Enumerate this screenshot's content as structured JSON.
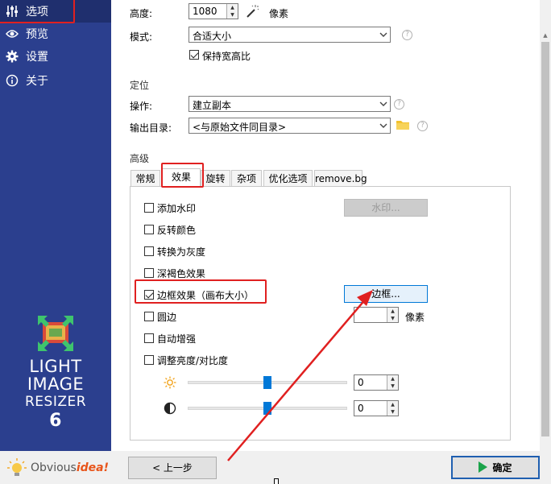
{
  "sidebar": {
    "items": [
      {
        "label": "选项",
        "icon": "sliders-icon"
      },
      {
        "label": "预览",
        "icon": "eye-icon"
      },
      {
        "label": "设置",
        "icon": "gear-icon"
      },
      {
        "label": "关于",
        "icon": "info-icon"
      }
    ],
    "logo_lines": [
      "LIGHT",
      "IMAGE",
      "RESIZER",
      "6"
    ],
    "brand_obvious": "Obvious",
    "brand_idea": "idea!"
  },
  "size": {
    "height_label": "高度:",
    "height_value": "1080",
    "unit": "像素",
    "mode_label": "模式:",
    "mode_value": "合适大小",
    "keep_ratio_label": "保持宽高比",
    "keep_ratio_checked": true
  },
  "position": {
    "section": "定位",
    "action_label": "操作:",
    "action_value": "建立副本",
    "output_label": "输出目录:",
    "output_value": "<与原始文件同目录>"
  },
  "advanced": {
    "section": "高级",
    "tabs": [
      "常规",
      "效果",
      "旋转",
      "杂项",
      "优化选项",
      "remove.bg"
    ],
    "active_tab": 1
  },
  "effects": {
    "watermark_label": "添加水印",
    "watermark_button": "水印...",
    "invert_label": "反转颜色",
    "grayscale_label": "转换为灰度",
    "sepia_label": "深褐色效果",
    "border_label": "边框效果（画布大小）",
    "border_checked": true,
    "border_button": "边框...",
    "round_label": "圆边",
    "round_unit": "像素",
    "auto_enhance_label": "自动增强",
    "brightness_contrast_label": "调整亮度/对比度",
    "brightness_value": "0",
    "contrast_value": "0",
    "brightness_level": 0.5,
    "contrast_level": 0.5
  },
  "footer": {
    "back_button": "< 上一步",
    "ok_button": "确定"
  },
  "colors": {
    "sidebar": "#2b3f8e",
    "accent": "#0078d7",
    "annotation": "#e02020",
    "ok_icon": "#1aa34a",
    "folder": "#f2c12e"
  }
}
